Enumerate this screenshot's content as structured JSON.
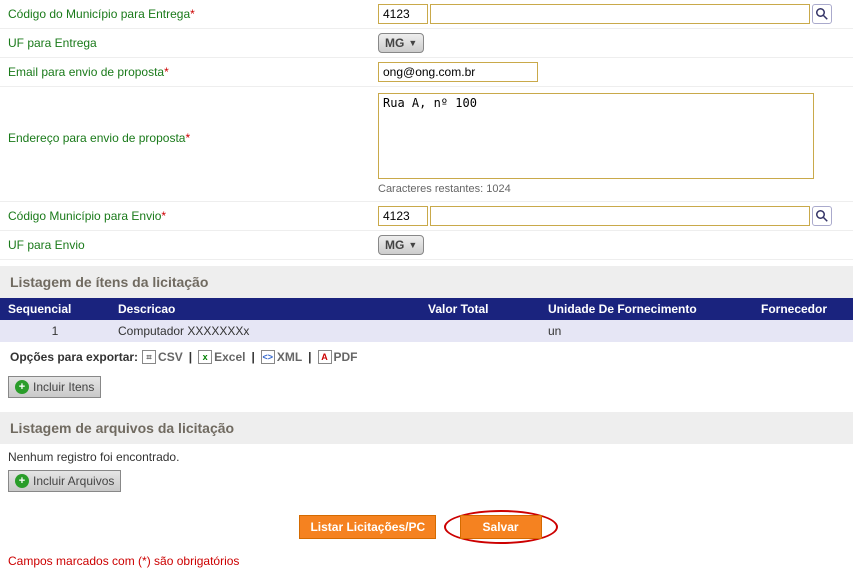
{
  "fields": {
    "codigo_entrega": {
      "label": "Código do Município para Entrega",
      "required": true,
      "code": "4123"
    },
    "uf_entrega": {
      "label": "UF para Entrega",
      "value": "MG"
    },
    "email": {
      "label": "Email para envio de proposta",
      "required": true,
      "value": "ong@ong.com.br"
    },
    "endereco": {
      "label": "Endereço para envio de proposta",
      "required": true,
      "value": "Rua A, nº 100",
      "chars_left_label": "Caracteres restantes: 1024"
    },
    "codigo_envio": {
      "label": "Código Município para Envio",
      "required": true,
      "code": "4123"
    },
    "uf_envio": {
      "label": "UF para Envio",
      "value": "MG"
    }
  },
  "itens_section": {
    "title": "Listagem de ítens da licitação",
    "columns": {
      "seq": "Sequencial",
      "desc": "Descricao",
      "valor": "Valor Total",
      "unidade": "Unidade De Fornecimento",
      "fornecedor": "Fornecedor"
    },
    "rows": [
      {
        "seq": "1",
        "desc": "Computador XXXXXXXx",
        "valor": "",
        "unidade": "un",
        "fornecedor": ""
      }
    ],
    "export_label": "Opções para exportar:",
    "export": {
      "csv": "CSV",
      "excel": "Excel",
      "xml": "XML",
      "pdf": "PDF"
    },
    "incluir_btn": "Incluir Itens"
  },
  "arquivos_section": {
    "title": "Listagem de arquivos da licitação",
    "none": "Nenhum registro foi encontrado.",
    "incluir_btn": "Incluir Arquivos"
  },
  "buttons": {
    "listar": "Listar Licitações/PC",
    "salvar": "Salvar"
  },
  "footnote": "Campos marcados com (*) são obrigatórios"
}
